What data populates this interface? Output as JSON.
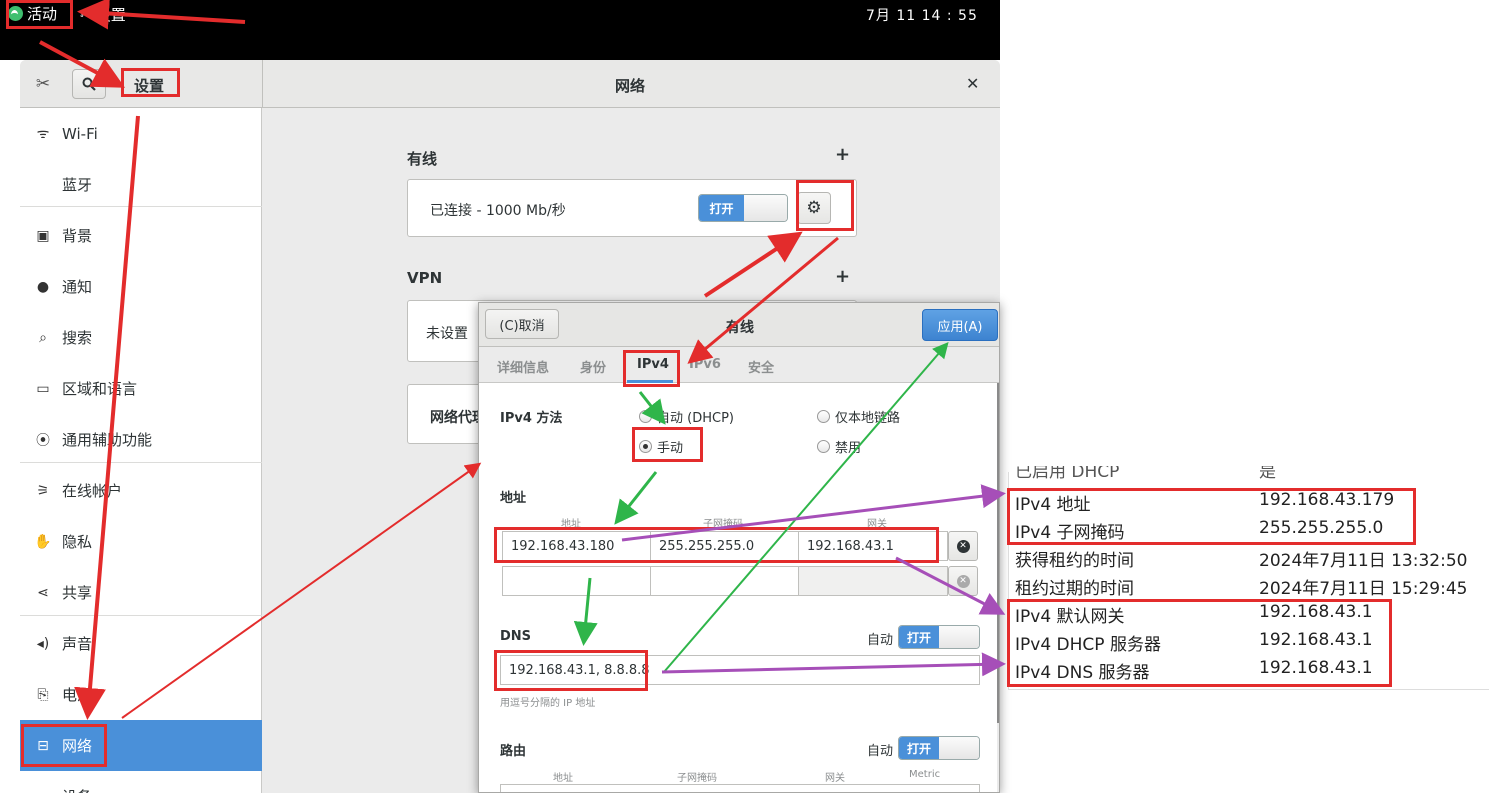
{
  "topbar": {
    "activities": "活动",
    "app_menu": "设置",
    "clock": "7月 11 14 : 55"
  },
  "headerbar": {
    "left_title": "设置",
    "main_title": "网络"
  },
  "sidebar": {
    "items": [
      {
        "label": "Wi-Fi",
        "icon": "wifi-icon"
      },
      {
        "label": "蓝牙",
        "icon": ""
      },
      {
        "label": "背景",
        "icon": "background-icon"
      },
      {
        "label": "通知",
        "icon": "bell-icon"
      },
      {
        "label": "搜索",
        "icon": "search-icon"
      },
      {
        "label": "区域和语言",
        "icon": "region-icon"
      },
      {
        "label": "通用辅助功能",
        "icon": "accessibility-icon"
      },
      {
        "label": "在线帐户",
        "icon": "online-accounts-icon"
      },
      {
        "label": "隐私",
        "icon": "hand-icon"
      },
      {
        "label": "共享",
        "icon": "share-icon"
      },
      {
        "label": "声音",
        "icon": "speaker-icon"
      },
      {
        "label": "电源",
        "icon": "power-icon"
      },
      {
        "label": "网络",
        "icon": "network-icon"
      },
      {
        "label": "设备",
        "icon": ""
      }
    ]
  },
  "network": {
    "wired_label": "有线",
    "wired_status": "已连接 - 1000 Mb/秒",
    "switch_on": "打开",
    "vpn_label": "VPN",
    "vpn_status": "未设置",
    "proxy_label": "网络代理"
  },
  "dialog": {
    "cancel": "(C)取消",
    "title": "有线",
    "behind_title": "有线",
    "apply": "应用(A)",
    "tabs": [
      "详细信息",
      "身份",
      "IPv4",
      "IPv6",
      "安全"
    ],
    "ipv4_method_label": "IPv4 方法",
    "methods": [
      "自动 (DHCP)",
      "仅本地链路",
      "手动",
      "禁用"
    ],
    "address_section": "地址",
    "col_address": "地址",
    "col_netmask": "子网掩码",
    "col_gateway": "网关",
    "address": "192.168.43.180",
    "netmask": "255.255.255.0",
    "gateway": "192.168.43.1",
    "dns_label": "DNS",
    "auto_label": "自动",
    "dns_value": "192.168.43.1, 8.8.8.8",
    "dns_hint": "用逗号分隔的 IP 地址",
    "routes_label": "路由",
    "routes_auto": "自动",
    "routes_cols": [
      "地址",
      "子网掩码",
      "网关",
      "Metric"
    ]
  },
  "info_panel": {
    "partial_top": "已启用 DHCP",
    "partial_top_value": "是",
    "rows": [
      {
        "key": "IPv4 地址",
        "value": "192.168.43.179"
      },
      {
        "key": "IPv4 子网掩码",
        "value": "255.255.255.0"
      },
      {
        "key": "获得租约的时间",
        "value": "2024年7月11日 13:32:50"
      },
      {
        "key": "租约过期的时间",
        "value": "2024年7月11日 15:29:45"
      },
      {
        "key": "IPv4 默认网关",
        "value": "192.168.43.1"
      },
      {
        "key": "IPv4 DHCP 服务器",
        "value": "192.168.43.1"
      },
      {
        "key": "IPv4 DNS 服务器",
        "value": "192.168.43.1"
      }
    ]
  },
  "colors": {
    "accent": "#4a90d9",
    "annotation_red": "#e32c2c",
    "annotation_green": "#2fb54a",
    "annotation_purple": "#a64fb8"
  }
}
